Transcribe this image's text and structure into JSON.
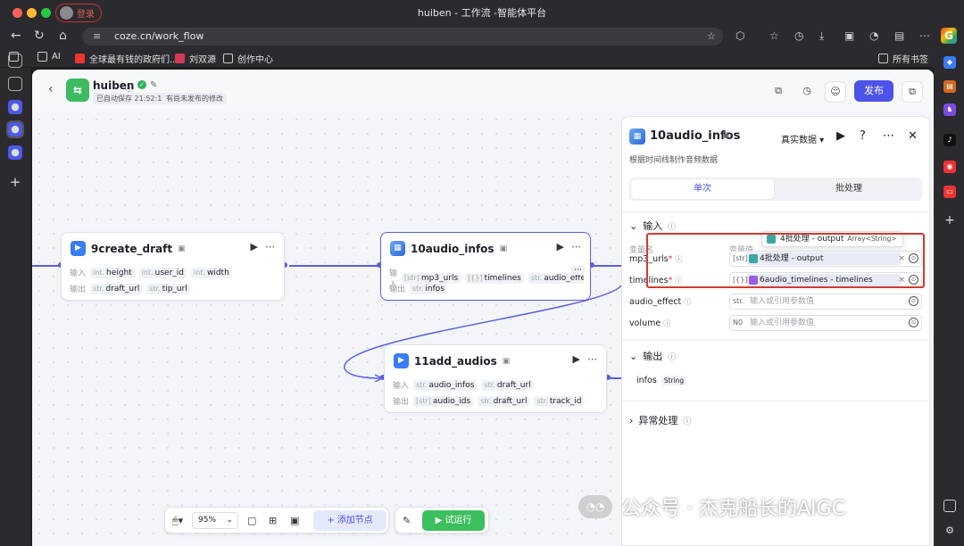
{
  "browser": {
    "window_title": "huiben - 工作流 -智能体平台",
    "login_label": "登录",
    "url": "coze.cn/work_flow",
    "bookmarks": [
      "AI",
      "全球最有钱的政府们...",
      "刘双源",
      "创作中心"
    ],
    "bookmarks_right": "所有书签"
  },
  "header": {
    "app_name": "huiben",
    "autosave": "已自动保存 21:52:17",
    "unpublished": "有尚未发布的修改",
    "publish_label": "发布"
  },
  "nodes": {
    "n9": {
      "title": "9create_draft",
      "in_label": "输入",
      "out_label": "输出",
      "inputs": [
        {
          "type": "int.",
          "name": "height"
        },
        {
          "type": "int.",
          "name": "user_id"
        },
        {
          "type": "int.",
          "name": "width"
        }
      ],
      "outputs": [
        {
          "type": "str.",
          "name": "draft_url"
        },
        {
          "type": "str.",
          "name": "tip_url"
        }
      ]
    },
    "n10": {
      "title": "10audio_infos",
      "in_label": "输入",
      "out_label": "输出",
      "inputs": [
        {
          "type": "[str]",
          "name": "mp3_urls"
        },
        {
          "type": "[{}]",
          "name": "timelines"
        },
        {
          "type": "str.",
          "name": "audio_effect"
        }
      ],
      "outputs": [
        {
          "type": "str.",
          "name": "infos"
        }
      ]
    },
    "n11": {
      "title": "11add_audios",
      "in_label": "输入",
      "out_label": "输出",
      "inputs": [
        {
          "type": "str.",
          "name": "audio_infos"
        },
        {
          "type": "str.",
          "name": "draft_url"
        }
      ],
      "outputs": [
        {
          "type": "[str]",
          "name": "audio_ids"
        },
        {
          "type": "str.",
          "name": "draft_url"
        },
        {
          "type": "str.",
          "name": "track_id"
        }
      ]
    }
  },
  "panel": {
    "title": "10audio_infos",
    "mode": "真实数据",
    "description": "根据时间线制作音频数据",
    "tab_single": "单次",
    "tab_batch": "批处理",
    "input_section": "输入",
    "col_varname": "变量名",
    "col_varvalue": "变量值",
    "tooltip_label": "4批处理 - output",
    "tooltip_type": "Array<String>",
    "params": [
      {
        "name": "mp3_urls",
        "required": "*",
        "prefix": "[str]",
        "ref": "4批处理 - output",
        "placeholder": ""
      },
      {
        "name": "timelines",
        "required": "*",
        "prefix": "[{}]",
        "ref": "6audio_timelines - timelines",
        "placeholder": ""
      },
      {
        "name": "audio_effect",
        "required": "",
        "prefix": "str.",
        "ref": "",
        "placeholder": "输入或引用参数值"
      },
      {
        "name": "volume",
        "required": "",
        "prefix": "N0",
        "ref": "",
        "placeholder": "输入或引用参数值"
      }
    ],
    "output_section": "输出",
    "output_name": "infos",
    "output_type": "String",
    "error_section": "异常处理"
  },
  "toolbar": {
    "zoom": "95%",
    "add_node": "添加节点",
    "trial_run": "试运行"
  },
  "watermark": "公众号 · 杰克船长的AIGC"
}
